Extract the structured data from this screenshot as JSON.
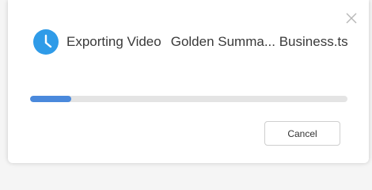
{
  "dialog": {
    "title": "Exporting Video",
    "file_name": "Golden Summa... Business.ts",
    "progress_fraction": 0.13,
    "cancel_label": "Cancel"
  },
  "icons": {
    "status": "clock-icon",
    "close": "close-icon"
  },
  "colors": {
    "accent": "#4a89dc",
    "clock": "#2f9be8",
    "track": "#e4e4e4"
  }
}
